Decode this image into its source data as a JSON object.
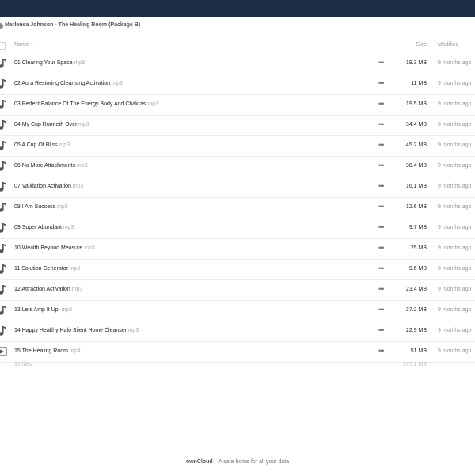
{
  "breadcrumb": {
    "title": "Marlenea Johnson - The Healing Room (Package B)"
  },
  "header": {
    "name": "Name",
    "sort_arrow": "▾",
    "size": "Size",
    "modified": "Modified"
  },
  "files": [
    {
      "base": "01 Clearing Your Space",
      "ext": ".mp3",
      "size": "19.3 MB",
      "modified": "9 months ago",
      "icon": "audio-file-icon"
    },
    {
      "base": "02 Aura Restoring Cleansing Activation",
      "ext": ".mp3",
      "size": "11 MB",
      "modified": "9 months ago",
      "icon": "audio-file-icon"
    },
    {
      "base": "03 Perfect Balance Of The Energy Body And Chakras",
      "ext": ".mp3",
      "size": "19.5 MB",
      "modified": "9 months ago",
      "icon": "audio-file-icon"
    },
    {
      "base": "04 My Cup Runneth Over",
      "ext": ".mp3",
      "size": "34.4 MB",
      "modified": "9 months ago",
      "icon": "audio-file-icon"
    },
    {
      "base": "05 A Cup Of Bliss",
      "ext": ".mp3",
      "size": "45.2 MB",
      "modified": "9 months ago",
      "icon": "audio-file-icon"
    },
    {
      "base": "06 No More Attachments",
      "ext": ".mp3",
      "size": "38.4 MB",
      "modified": "9 months ago",
      "icon": "audio-file-icon"
    },
    {
      "base": "07 Validation Activation",
      "ext": ".mp3",
      "size": "16.1 MB",
      "modified": "9 months ago",
      "icon": "audio-file-icon"
    },
    {
      "base": "08 I Am Success",
      "ext": ".mp3",
      "size": "12.6 MB",
      "modified": "9 months ago",
      "icon": "audio-file-icon"
    },
    {
      "base": "09 Super Abundant",
      "ext": ".mp3",
      "size": "9.7 MB",
      "modified": "9 months ago",
      "icon": "audio-file-icon"
    },
    {
      "base": "10 Wealth Beyond Measure",
      "ext": ".mp3",
      "size": "25 MB",
      "modified": "9 months ago",
      "icon": "audio-file-icon"
    },
    {
      "base": "11 Solution Generator",
      "ext": ".mp3",
      "size": "9.6 MB",
      "modified": "9 months ago",
      "icon": "audio-file-icon"
    },
    {
      "base": "12 Attraction Activation",
      "ext": ".mp3",
      "size": "23.4 MB",
      "modified": "9 months ago",
      "icon": "audio-file-icon"
    },
    {
      "base": "13 Lets Amp It Up!",
      "ext": ".mp3",
      "size": "37.2 MB",
      "modified": "9 months ago",
      "icon": "audio-file-icon"
    },
    {
      "base": "14 Happy Healthy Halo Silent Home Cleanser",
      "ext": ".mp3",
      "size": "22.9 MB",
      "modified": "9 months ago",
      "icon": "audio-file-icon"
    },
    {
      "base": "15 The Healing Room",
      "ext": ".mp4",
      "size": "51 MB",
      "modified": "9 months ago",
      "icon": "video-file-icon"
    }
  ],
  "actions_glyph": "•••",
  "summary": {
    "files": "15 files",
    "total": "375.1 MB"
  },
  "footer": {
    "brand": "ownCloud",
    "tagline": " – A safe home for all your data"
  },
  "colors": {
    "topbar": "#1d2d44"
  }
}
